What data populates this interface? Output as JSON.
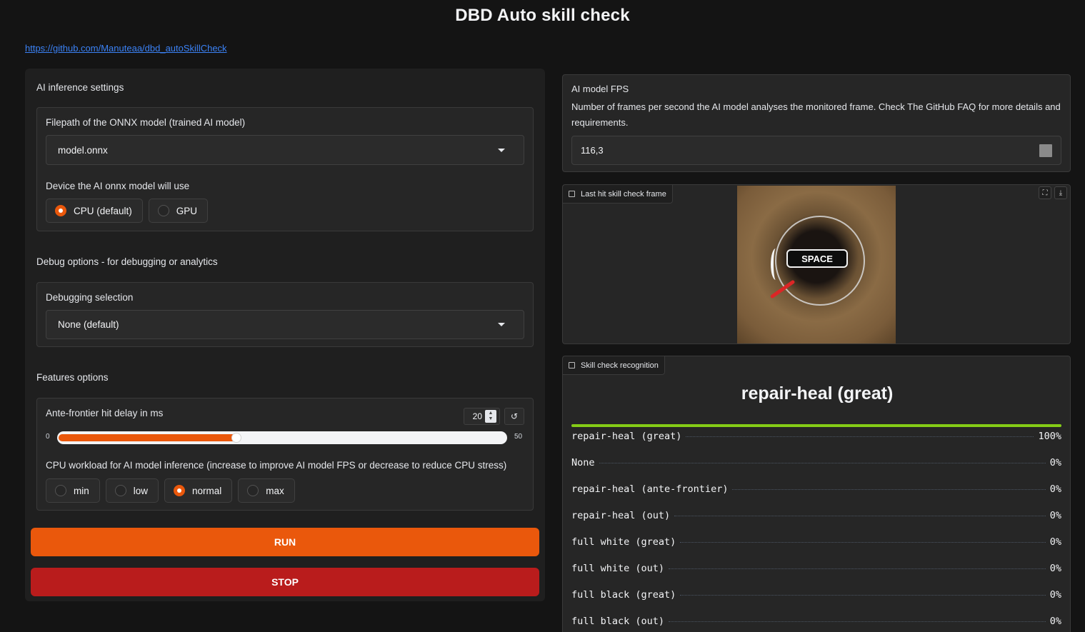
{
  "title": "DBD Auto skill check",
  "repo_link": "https://github.com/Manuteaa/dbd_autoSkillCheck",
  "left": {
    "ai_section_title": "AI inference settings",
    "model_label": "Filepath of the ONNX model (trained AI model)",
    "model_value": "model.onnx",
    "device_label": "Device the AI onnx model will use",
    "device_options": [
      {
        "label": "CPU (default)",
        "selected": true
      },
      {
        "label": "GPU",
        "selected": false
      }
    ],
    "debug_section_title": "Debug options - for debugging or analytics",
    "debug_label": "Debugging selection",
    "debug_value": "None (default)",
    "features_section_title": "Features options",
    "delay_label": "Ante-frontier hit delay in ms",
    "delay_value": "20",
    "delay_fraction": 0.4,
    "slider_min": "0",
    "slider_max": "50",
    "reset_icon": "↺",
    "cpu_label": "CPU workload for AI model inference (increase to improve AI model FPS or decrease to reduce CPU stress)",
    "cpu_options": [
      {
        "label": "min",
        "selected": false
      },
      {
        "label": "low",
        "selected": false
      },
      {
        "label": "normal",
        "selected": true
      },
      {
        "label": "max",
        "selected": false
      }
    ],
    "run_label": "RUN",
    "stop_label": "STOP"
  },
  "right": {
    "fps_title": "AI model FPS",
    "fps_desc": "Number of frames per second the AI model analyses the monitored frame. Check The GitHub FAQ for more details and requirements.",
    "fps_value": "116,3",
    "frame_tab": "Last hit skill check frame",
    "space_key": "SPACE",
    "recog_tab": "Skill check recognition",
    "result_label": "repair-heal (great)",
    "top_fraction": 1.0,
    "confidences": [
      {
        "label": "repair-heal (great)",
        "value": "100%"
      },
      {
        "label": "None",
        "value": "0%"
      },
      {
        "label": "repair-heal (ante-frontier)",
        "value": "0%"
      },
      {
        "label": "repair-heal (out)",
        "value": "0%"
      },
      {
        "label": "full white (great)",
        "value": "0%"
      },
      {
        "label": "full white (out)",
        "value": "0%"
      },
      {
        "label": "full black (great)",
        "value": "0%"
      },
      {
        "label": "full black (out)",
        "value": "0%"
      }
    ]
  },
  "colors": {
    "accent": "#ea580c",
    "stop": "#b91c1c",
    "link": "#3b82f6",
    "confidence_bar": "#84cc16"
  }
}
